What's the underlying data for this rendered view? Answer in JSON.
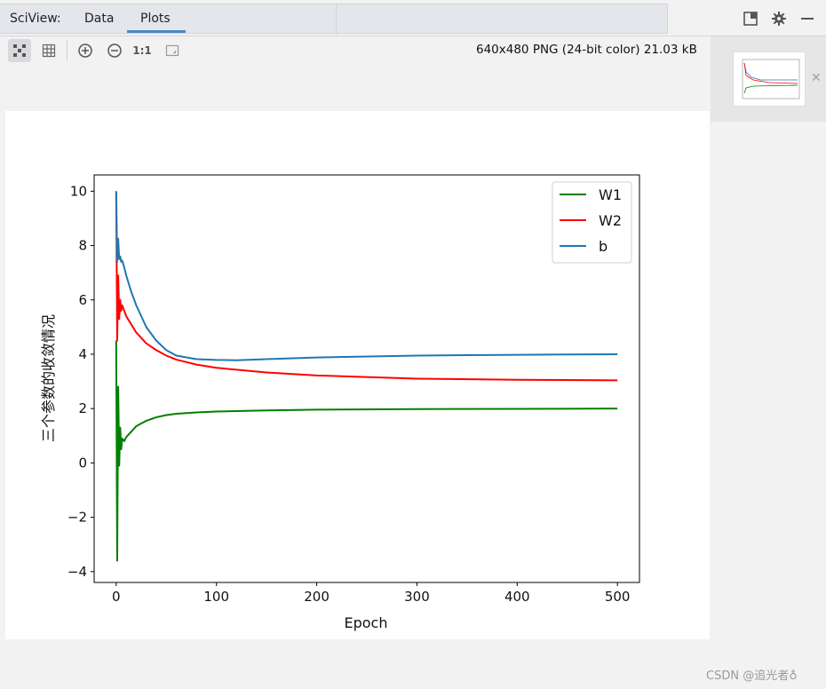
{
  "header": {
    "app_label": "SciView:",
    "tabs": [
      {
        "label": "Data"
      },
      {
        "label": "Plots"
      }
    ],
    "active_tab": "Plots"
  },
  "toolbar": {
    "buttons": [
      "fit-to-window-icon",
      "grid-icon",
      "zoom-in-icon",
      "zoom-out-icon",
      "actual-size-icon",
      "fit-screen-icon"
    ],
    "actual_size_label": "1:1"
  },
  "file_info": "640x480 PNG (24-bit color) 21.03 kB",
  "watermark": "CSDN @追光者♁",
  "chart_data": {
    "type": "line",
    "title": "",
    "xlabel": "Epoch",
    "ylabel": "三个参数的收敛情况",
    "xlim": [
      -22,
      522
    ],
    "ylim": [
      -4.4,
      10.6
    ],
    "xticks": [
      0,
      100,
      200,
      300,
      400,
      500
    ],
    "yticks": [
      -4,
      -2,
      0,
      2,
      4,
      6,
      8,
      10
    ],
    "xtick_labels": [
      "0",
      "100",
      "200",
      "300",
      "400",
      "500"
    ],
    "ytick_labels": [
      "−4",
      "−2",
      "0",
      "2",
      "4",
      "6",
      "8",
      "10"
    ],
    "grid": false,
    "legend": "top-right",
    "series": [
      {
        "name": "W1",
        "color": "#008000",
        "x": [
          0,
          1,
          2,
          3,
          4,
          5,
          6,
          8,
          10,
          15,
          20,
          30,
          40,
          50,
          60,
          80,
          100,
          150,
          200,
          300,
          400,
          500
        ],
        "y": [
          4.5,
          -3.6,
          2.8,
          -0.1,
          1.3,
          0.5,
          0.9,
          0.8,
          0.95,
          1.15,
          1.35,
          1.55,
          1.68,
          1.76,
          1.81,
          1.86,
          1.89,
          1.93,
          1.96,
          1.98,
          1.99,
          2.0
        ]
      },
      {
        "name": "W2",
        "color": "#ff0000",
        "x": [
          0,
          1,
          2,
          3,
          4,
          5,
          6,
          8,
          10,
          15,
          20,
          30,
          40,
          50,
          60,
          80,
          100,
          150,
          200,
          300,
          400,
          500
        ],
        "y": [
          10.0,
          4.5,
          6.9,
          5.3,
          6.0,
          5.6,
          5.8,
          5.6,
          5.4,
          5.1,
          4.8,
          4.4,
          4.15,
          3.95,
          3.8,
          3.62,
          3.5,
          3.33,
          3.22,
          3.1,
          3.06,
          3.04
        ]
      },
      {
        "name": "b",
        "color": "#1f77b4",
        "x": [
          0,
          1,
          2,
          3,
          4,
          5,
          6,
          8,
          10,
          15,
          20,
          30,
          40,
          50,
          60,
          80,
          100,
          120,
          150,
          200,
          300,
          400,
          500
        ],
        "y": [
          10.0,
          7.4,
          8.25,
          7.5,
          7.6,
          7.4,
          7.45,
          7.2,
          6.9,
          6.3,
          5.8,
          5.0,
          4.5,
          4.15,
          3.95,
          3.82,
          3.79,
          3.78,
          3.82,
          3.88,
          3.95,
          3.98,
          4.0
        ]
      }
    ]
  }
}
